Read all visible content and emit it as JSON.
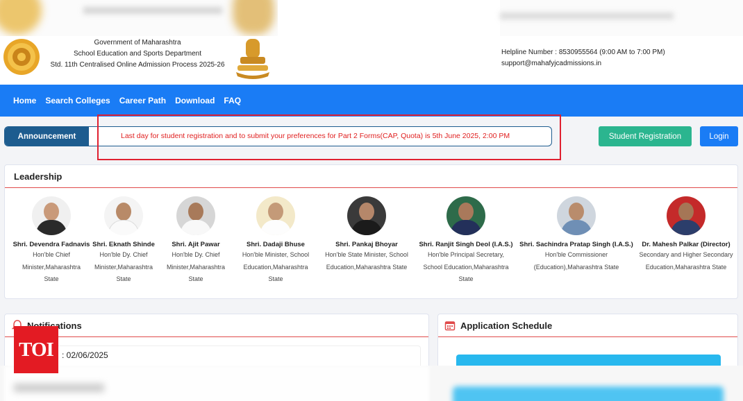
{
  "header": {
    "org_line1": "Government of Maharashtra",
    "org_line2": "School Education and Sports Department",
    "org_line3": "Std. 11th Centralised Online Admission Process 2025-26",
    "helpline": "Helpline Number : 8530955564 (9:00 AM to 7:00 PM)",
    "email": "support@mahafyjcadmissions.in"
  },
  "nav": {
    "items": [
      "Home",
      "Search Colleges",
      "Career Path",
      "Download",
      "FAQ"
    ]
  },
  "announcement": {
    "label": "Announcement",
    "text": "Last day for student registration and to submit your preferences for Part 2 Forms(CAP, Quota) is 5th June 2025, 2:00 PM"
  },
  "actions": {
    "register": "Student Registration",
    "login": "Login"
  },
  "leadership": {
    "title": "Leadership",
    "leaders": [
      {
        "name": "Shri. Devendra Fadnavis",
        "role1": "Hon'ble Chief",
        "role2": "Minister,Maharashtra",
        "role3": "State"
      },
      {
        "name": "Shri. Eknath Shinde",
        "role1": "Hon'ble Dy. Chief",
        "role2": "Minister,Maharashtra",
        "role3": "State"
      },
      {
        "name": "Shri. Ajit Pawar",
        "role1": "Hon'ble Dy. Chief",
        "role2": "Minister,Maharashtra",
        "role3": "State"
      },
      {
        "name": "Shri. Dadaji Bhuse",
        "role1": "Hon'ble Minister, School",
        "role2": "Education,Maharashtra",
        "role3": "State"
      },
      {
        "name": "Shri. Pankaj Bhoyar",
        "role1": "Hon'ble State Minister, School",
        "role2": "Education,Maharashtra State",
        "role3": ""
      },
      {
        "name": "Shri. Ranjit Singh Deol (I.A.S.)",
        "role1": "Hon'ble Principal Secretary,",
        "role2": "School Education,Maharashtra",
        "role3": "State"
      },
      {
        "name": "Shri. Sachindra Pratap Singh (I.A.S.)",
        "role1": "Hon'ble Commissioner",
        "role2": "(Education),Maharashtra State",
        "role3": ""
      },
      {
        "name": "Dr. Mahesh Palkar (Director)",
        "role1": "Secondary and Higher Secondary",
        "role2": "Education,Maharashtra State",
        "role3": ""
      }
    ]
  },
  "notifications": {
    "title": "Notifications",
    "date": ": 02/06/2025"
  },
  "schedule": {
    "title": "Application Schedule"
  },
  "watermark": "TOI",
  "colors": {
    "nav_blue": "#1a7cf5",
    "announcement_navy": "#1d5c8f",
    "announcement_red": "#e02020",
    "register_green": "#2bb58f",
    "toi_red": "#e31b23"
  }
}
